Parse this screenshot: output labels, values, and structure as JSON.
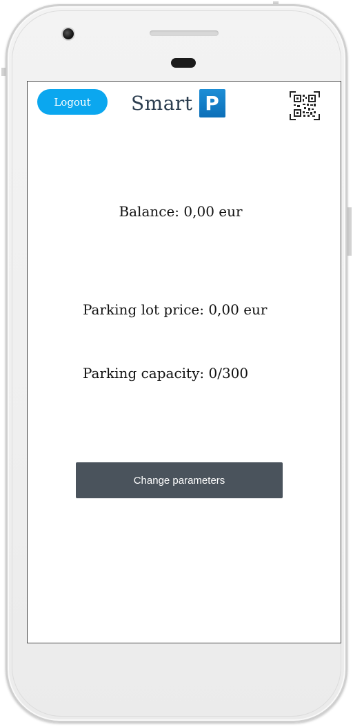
{
  "header": {
    "logout_label": "Logout",
    "brand_text": "Smart",
    "brand_badge": "P",
    "qr_icon": "qr-code-icon"
  },
  "main": {
    "balance": "Balance: 0,00 eur",
    "parking_lot_price": "Parking lot price: 0,00 eur",
    "parking_capacity": "Parking capacity: 0/300",
    "change_parameters_label": "Change parameters"
  },
  "colors": {
    "logout_bg": "#0ba7ef",
    "brand_badge_bg": "#1d8ed6",
    "button_dark": "#4a535c"
  }
}
